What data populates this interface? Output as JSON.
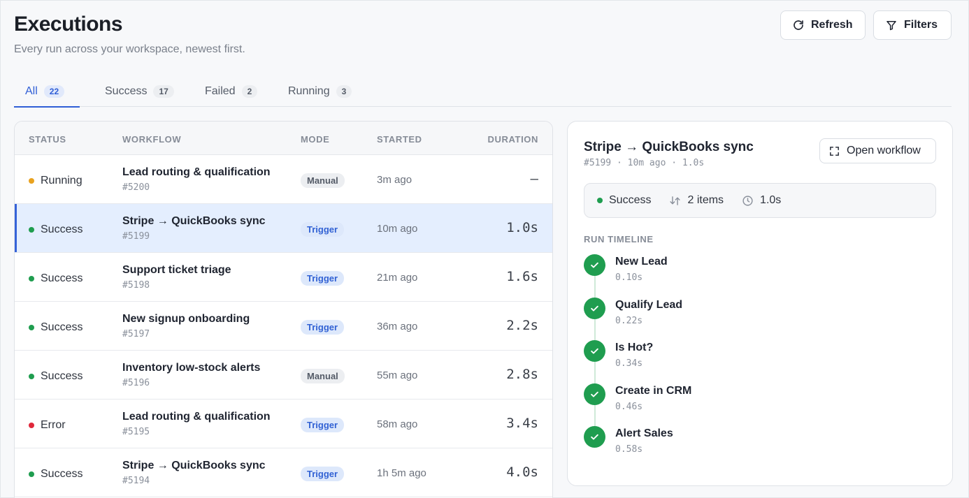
{
  "header": {
    "title": "Executions",
    "subtitle": "Every run across your workspace, newest first.",
    "refresh_label": "Refresh",
    "filters_label": "Filters"
  },
  "tabs": [
    {
      "label": "All",
      "count": "22"
    },
    {
      "label": "Success",
      "count": "17"
    },
    {
      "label": "Failed",
      "count": "2"
    },
    {
      "label": "Running",
      "count": "3"
    }
  ],
  "table": {
    "columns": {
      "status": "STATUS",
      "workflow": "WORKFLOW",
      "mode": "MODE",
      "started": "STARTED",
      "duration": "DURATION"
    },
    "rows": [
      {
        "status": "Running",
        "name": "Lead routing & qualification",
        "id": "#5200",
        "mode": "Manual",
        "started": "3m ago",
        "duration": "—"
      },
      {
        "status": "Success",
        "name": "Stripe → QuickBooks sync",
        "id": "#5199",
        "mode": "Trigger",
        "started": "10m ago",
        "duration": "1.0s"
      },
      {
        "status": "Success",
        "name": "Support ticket triage",
        "id": "#5198",
        "mode": "Trigger",
        "started": "21m ago",
        "duration": "1.6s"
      },
      {
        "status": "Success",
        "name": "New signup onboarding",
        "id": "#5197",
        "mode": "Trigger",
        "started": "36m ago",
        "duration": "2.2s"
      },
      {
        "status": "Success",
        "name": "Inventory low-stock alerts",
        "id": "#5196",
        "mode": "Manual",
        "started": "55m ago",
        "duration": "2.8s"
      },
      {
        "status": "Error",
        "name": "Lead routing & qualification",
        "id": "#5195",
        "mode": "Trigger",
        "started": "58m ago",
        "duration": "3.4s"
      },
      {
        "status": "Success",
        "name": "Stripe → QuickBooks sync",
        "id": "#5194",
        "mode": "Trigger",
        "started": "1h 5m ago",
        "duration": "4.0s"
      }
    ]
  },
  "detail": {
    "title": "Stripe → QuickBooks sync",
    "meta": "#5199 · 10m ago · 1.0s",
    "open_label": "Open workflow",
    "summary": {
      "status": "Success",
      "items": "2 items",
      "duration": "1.0s"
    },
    "timeline_label": "RUN TIMELINE",
    "steps": [
      {
        "name": "New Lead",
        "time": "0.10s"
      },
      {
        "name": "Qualify Lead",
        "time": "0.22s"
      },
      {
        "name": "Is Hot?",
        "time": "0.34s"
      },
      {
        "name": "Create in CRM",
        "time": "0.46s"
      },
      {
        "name": "Alert Sales",
        "time": "0.58s"
      }
    ]
  },
  "colors": {
    "accent": "#2f5ed6",
    "success": "#1f9d4f",
    "running": "#e9a21f",
    "error": "#e0283b"
  }
}
